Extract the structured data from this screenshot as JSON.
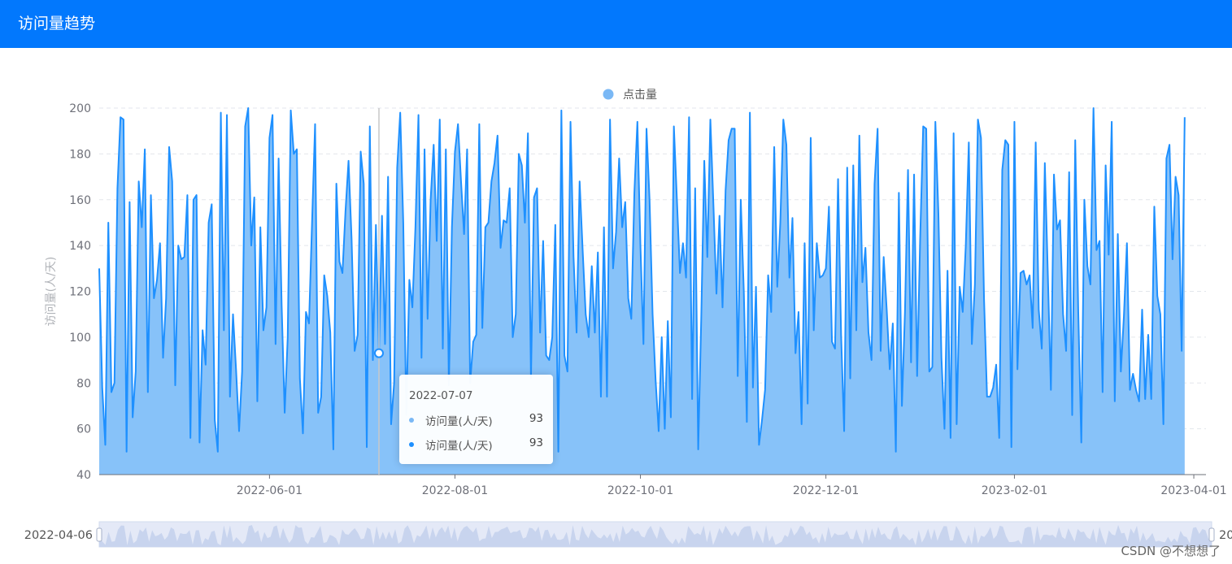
{
  "header": {
    "title": "访问量趋势"
  },
  "legend": {
    "label": "点击量",
    "color": "#7ab8f5"
  },
  "colors": {
    "line": "#1e90ff",
    "area": "#87c2f9",
    "header": "#0278fd",
    "slider_fill": "#c8d4ee",
    "slider_bg": "#e4e9f7"
  },
  "chart_data": {
    "type": "area",
    "ylabel": "访问量(人/天)",
    "ylim": [
      40,
      200
    ],
    "y_ticks": [
      40,
      60,
      80,
      100,
      120,
      140,
      160,
      180,
      200
    ],
    "x_ticks": [
      "2022-06-01",
      "2022-08-01",
      "2022-10-01",
      "2022-12-01",
      "2023-02-01",
      "2023-04-01"
    ],
    "x_range": [
      "2022-04-06",
      "2023-04-05"
    ],
    "series": [
      {
        "name": "访问量(人/天)",
        "start_date": "2022-04-06",
        "values": [
          130,
          78,
          53,
          150,
          76,
          80,
          165,
          196,
          195,
          50,
          159,
          65,
          85,
          168,
          148,
          182,
          76,
          162,
          117,
          125,
          141,
          91,
          117,
          183,
          168,
          79,
          140,
          134,
          135,
          162,
          56,
          160,
          162,
          54,
          103,
          88,
          150,
          158,
          64,
          50,
          198,
          103,
          197,
          74,
          110,
          86,
          59,
          85,
          192,
          200,
          140,
          161,
          72,
          148,
          103,
          113,
          187,
          197,
          97,
          178,
          114,
          67,
          100,
          199,
          180,
          182,
          82,
          58,
          111,
          106,
          150,
          193,
          67,
          74,
          127,
          118,
          102,
          51,
          167,
          133,
          128,
          155,
          177,
          143,
          94,
          101,
          181,
          167,
          52,
          192,
          90,
          149,
          93,
          153,
          97,
          170,
          62,
          80,
          174,
          198,
          150,
          66,
          125,
          113,
          148,
          197,
          91,
          182,
          108,
          160,
          184,
          142,
          195,
          95,
          182,
          79,
          148,
          181,
          193,
          168,
          145,
          182,
          80,
          98,
          101,
          193,
          104,
          148,
          150,
          168,
          176,
          188,
          139,
          151,
          150,
          165,
          100,
          110,
          180,
          175,
          150,
          189,
          82,
          161,
          165,
          102,
          142,
          92,
          90,
          100,
          149,
          50,
          199,
          92,
          85,
          194,
          135,
          102,
          168,
          138,
          110,
          100,
          131,
          102,
          137,
          74,
          148,
          74,
          195,
          130,
          146,
          178,
          148,
          159,
          117,
          108,
          163,
          194,
          140,
          97,
          191,
          160,
          110,
          81,
          59,
          100,
          60,
          107,
          65,
          192,
          160,
          128,
          141,
          126,
          196,
          73,
          165,
          51,
          108,
          177,
          135,
          195,
          158,
          119,
          153,
          113,
          164,
          186,
          191,
          191,
          83,
          160,
          120,
          63,
          198,
          78,
          122,
          53,
          64,
          77,
          127,
          111,
          183,
          122,
          150,
          195,
          184,
          126,
          152,
          93,
          111,
          62,
          141,
          71,
          187,
          103,
          141,
          126,
          127,
          130,
          157,
          98,
          95,
          169,
          101,
          59,
          174,
          82,
          175,
          103,
          188,
          124,
          139,
          102,
          90,
          167,
          191,
          94,
          135,
          112,
          86,
          106,
          50,
          163,
          70,
          111,
          173,
          89,
          171,
          83,
          143,
          192,
          191,
          85,
          87,
          194,
          154,
          91,
          60,
          129,
          56,
          189,
          62,
          122,
          111,
          140,
          185,
          97,
          123,
          195,
          187,
          117,
          74,
          74,
          78,
          88,
          56,
          173,
          186,
          184,
          52,
          194,
          86,
          128,
          129,
          123,
          127,
          104,
          185,
          112,
          95,
          176,
          127,
          77,
          171,
          147,
          151,
          110,
          94,
          172,
          66,
          186,
          111,
          54,
          160,
          131,
          123,
          200,
          138,
          142,
          76,
          175,
          136,
          194,
          72,
          145,
          85,
          109,
          141,
          77,
          84,
          77,
          72,
          112,
          73,
          101,
          73,
          157,
          118,
          110,
          62,
          178,
          184,
          134,
          170,
          162,
          94,
          196
        ]
      }
    ],
    "tooltip": {
      "date": "2022-07-07",
      "rows": [
        {
          "name": "访问量(人/天)",
          "value": "93",
          "color": "#7ab8f5"
        },
        {
          "name": "访问量(人/天)",
          "value": "93",
          "color": "#1e90ff"
        }
      ],
      "index": 92
    },
    "slider": {
      "start_label": "2022-04-06",
      "end_label": "20"
    }
  },
  "watermark": "CSDN @不想想了"
}
